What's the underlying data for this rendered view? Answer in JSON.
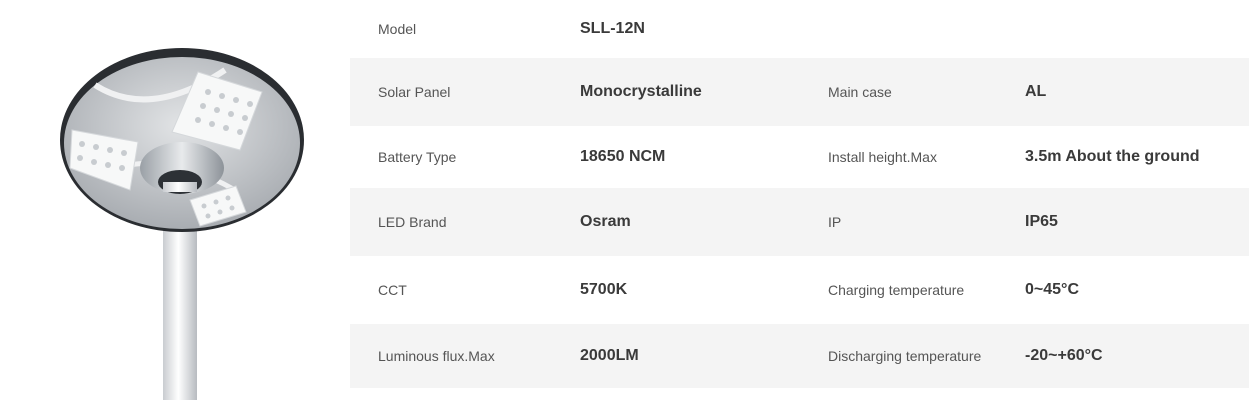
{
  "specs": {
    "rows": [
      {
        "label1": "Model",
        "value1": "SLL-12N",
        "label2": "",
        "value2": ""
      },
      {
        "label1": "Solar Panel",
        "value1": "Monocrystalline",
        "label2": "Main case",
        "value2": "AL"
      },
      {
        "label1": "Battery Type",
        "value1": "18650 NCM",
        "label2": "Install height.Max",
        "value2": "3.5m About the ground"
      },
      {
        "label1": "LED Brand",
        "value1": "Osram",
        "label2": "IP",
        "value2": "IP65"
      },
      {
        "label1": "CCT",
        "value1": "5700K",
        "label2": "Charging temperature",
        "value2": "0~45°C"
      },
      {
        "label1": "Luminous flux.Max",
        "value1": "2000LM",
        "label2": "Discharging temperature",
        "value2": "-20~+60°C"
      }
    ]
  },
  "colors": {
    "row_shade": "#f4f4f4",
    "label_text": "#555555",
    "value_text": "#3a3a3a"
  }
}
